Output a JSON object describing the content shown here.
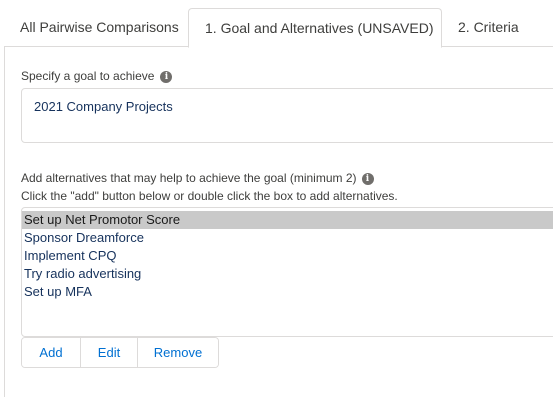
{
  "tabs": [
    {
      "label": "All Pairwise Comparisons"
    },
    {
      "label": "1. Goal and Alternatives (UNSAVED)"
    },
    {
      "label": "2. Criteria"
    }
  ],
  "goal": {
    "label": "Specify a goal to achieve",
    "value": "2021 Company Projects"
  },
  "alternatives": {
    "label": "Add alternatives that may help to achieve the goal (minimum 2)",
    "hint": "Click the \"add\" button below or double click the box to add alternatives.",
    "items": [
      "Set up Net Promotor Score",
      "Sponsor Dreamforce",
      "Implement CPQ",
      "Try radio advertising",
      "Set up MFA"
    ],
    "selected_index": 0
  },
  "buttons": {
    "add": "Add",
    "edit": "Edit",
    "remove": "Remove"
  },
  "icons": {
    "info_glyph": "i"
  },
  "colors": {
    "link": "#0070d2",
    "border": "#dddbda",
    "selected_bg": "#c9c9c9",
    "text": "#16325c"
  }
}
